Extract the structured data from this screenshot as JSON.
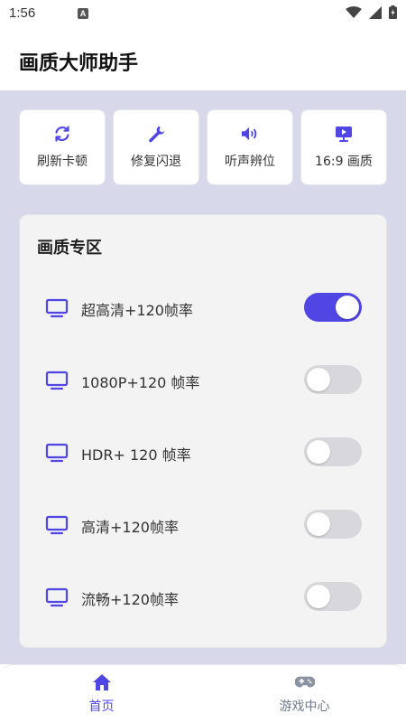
{
  "status_bar": {
    "time": "1:56",
    "badge": "A"
  },
  "header": {
    "title": "画质大师助手"
  },
  "quick_actions": [
    {
      "label": "刷新卡顿",
      "icon": "refresh-icon"
    },
    {
      "label": "修复闪退",
      "icon": "wrench-icon"
    },
    {
      "label": "听声辨位",
      "icon": "speaker-icon"
    },
    {
      "label": "16:9 画质",
      "icon": "monitor-play-icon"
    }
  ],
  "panel": {
    "title": "画质专区",
    "options": [
      {
        "label": "超高清+120帧率",
        "on": true
      },
      {
        "label": "1080P+120 帧率",
        "on": false
      },
      {
        "label": "HDR+ 120 帧率",
        "on": false
      },
      {
        "label": "高清+120帧率",
        "on": false
      },
      {
        "label": "流畅+120帧率",
        "on": false
      }
    ]
  },
  "bottom_nav": [
    {
      "label": "首页",
      "icon": "home-icon",
      "active": true
    },
    {
      "label": "游戏中心",
      "icon": "gamepad-icon",
      "active": false
    }
  ],
  "colors": {
    "accent": "#5046e4",
    "inactive": "#6f7a8c",
    "background": "#d7d9ea"
  }
}
